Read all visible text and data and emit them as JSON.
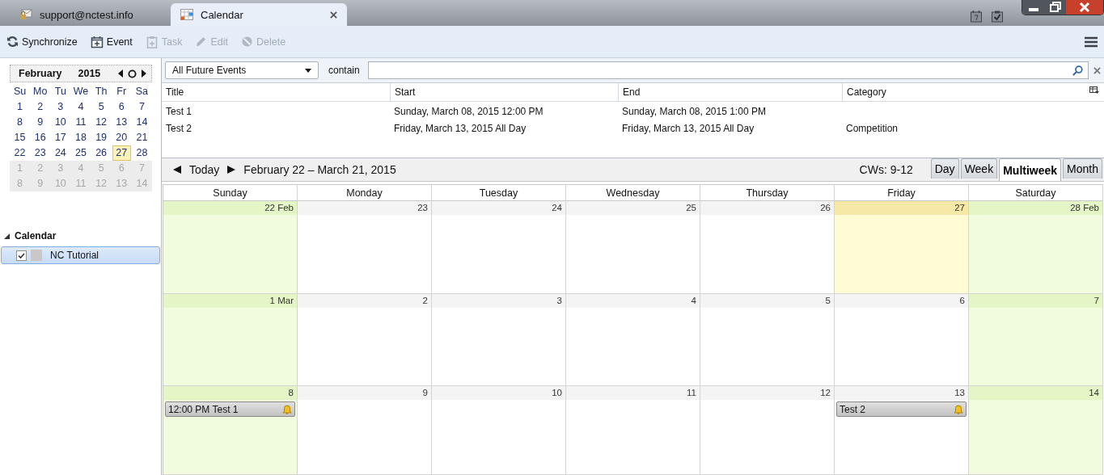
{
  "tabs": [
    {
      "kind": "mail",
      "label": "support@nctest.info",
      "selected": false,
      "closable": false
    },
    {
      "kind": "calendar",
      "label": "Calendar",
      "selected": true,
      "closable": true
    }
  ],
  "toolbar": [
    {
      "kind": "sync",
      "label": "Synchronize",
      "disabled": false
    },
    {
      "kind": "event",
      "label": "Event",
      "disabled": false
    },
    {
      "kind": "task",
      "label": "Task",
      "disabled": true
    },
    {
      "kind": "edit",
      "label": "Edit",
      "disabled": true
    },
    {
      "kind": "delete",
      "label": "Delete",
      "disabled": true
    }
  ],
  "minimonth": {
    "month": "February",
    "year": "2015",
    "weekdays": [
      "Su",
      "Mo",
      "Tu",
      "We",
      "Th",
      "Fr",
      "Sa"
    ],
    "weeks": [
      [
        {
          "day": "1",
          "outside": false,
          "selected": false
        },
        {
          "day": "2",
          "outside": false,
          "selected": false
        },
        {
          "day": "3",
          "outside": false,
          "selected": false
        },
        {
          "day": "4",
          "outside": false,
          "selected": false
        },
        {
          "day": "5",
          "outside": false,
          "selected": false
        },
        {
          "day": "6",
          "outside": false,
          "selected": false
        },
        {
          "day": "7",
          "outside": false,
          "selected": false
        }
      ],
      [
        {
          "day": "8",
          "outside": false,
          "selected": false
        },
        {
          "day": "9",
          "outside": false,
          "selected": false
        },
        {
          "day": "10",
          "outside": false,
          "selected": false
        },
        {
          "day": "11",
          "outside": false,
          "selected": false
        },
        {
          "day": "12",
          "outside": false,
          "selected": false
        },
        {
          "day": "13",
          "outside": false,
          "selected": false
        },
        {
          "day": "14",
          "outside": false,
          "selected": false
        }
      ],
      [
        {
          "day": "15",
          "outside": false,
          "selected": false
        },
        {
          "day": "16",
          "outside": false,
          "selected": false
        },
        {
          "day": "17",
          "outside": false,
          "selected": false
        },
        {
          "day": "18",
          "outside": false,
          "selected": false
        },
        {
          "day": "19",
          "outside": false,
          "selected": false
        },
        {
          "day": "20",
          "outside": false,
          "selected": false
        },
        {
          "day": "21",
          "outside": false,
          "selected": false
        }
      ],
      [
        {
          "day": "22",
          "outside": false,
          "selected": false
        },
        {
          "day": "23",
          "outside": false,
          "selected": false
        },
        {
          "day": "24",
          "outside": false,
          "selected": false
        },
        {
          "day": "25",
          "outside": false,
          "selected": false
        },
        {
          "day": "26",
          "outside": false,
          "selected": false
        },
        {
          "day": "27",
          "outside": false,
          "selected": true
        },
        {
          "day": "28",
          "outside": false,
          "selected": false
        }
      ],
      [
        {
          "day": "1",
          "outside": true,
          "selected": false
        },
        {
          "day": "2",
          "outside": true,
          "selected": false
        },
        {
          "day": "3",
          "outside": true,
          "selected": false
        },
        {
          "day": "4",
          "outside": true,
          "selected": false
        },
        {
          "day": "5",
          "outside": true,
          "selected": false
        },
        {
          "day": "6",
          "outside": true,
          "selected": false
        },
        {
          "day": "7",
          "outside": true,
          "selected": false
        }
      ],
      [
        {
          "day": "8",
          "outside": true,
          "selected": false
        },
        {
          "day": "9",
          "outside": true,
          "selected": false
        },
        {
          "day": "10",
          "outside": true,
          "selected": false
        },
        {
          "day": "11",
          "outside": true,
          "selected": false
        },
        {
          "day": "12",
          "outside": true,
          "selected": false
        },
        {
          "day": "13",
          "outside": true,
          "selected": false
        },
        {
          "day": "14",
          "outside": true,
          "selected": false
        }
      ]
    ]
  },
  "calendars": {
    "heading": "Calendar",
    "expanded": true,
    "items": [
      {
        "name": "NC Tutorial",
        "checked": true,
        "selected": true,
        "color": "#c8c8c8"
      }
    ]
  },
  "filter": {
    "value": "All Future Events",
    "label": "contain"
  },
  "event_list": {
    "columns": [
      "Title",
      "Start",
      "End",
      "Category"
    ],
    "rows": [
      [
        "Test 1",
        "Sunday, March 08, 2015 12:00 PM",
        "Sunday, March 08, 2015 1:00 PM",
        ""
      ],
      [
        "Test 2",
        "Friday, March 13, 2015 All Day",
        "Friday, March 13, 2015 All Day",
        "Competition"
      ]
    ]
  },
  "nav": {
    "today": "Today",
    "range": "February 22 – March 21, 2015",
    "weeks_label": "CWs: 9-12",
    "views": [
      {
        "label": "Day",
        "selected": false
      },
      {
        "label": "Week",
        "selected": false
      },
      {
        "label": "Multiweek",
        "selected": true
      },
      {
        "label": "Month",
        "selected": false
      }
    ]
  },
  "multiweek": {
    "weekdays": [
      "Sunday",
      "Monday",
      "Tuesday",
      "Wednesday",
      "Thursday",
      "Friday",
      "Saturday"
    ],
    "weeks": [
      [
        {
          "label": "22 Feb",
          "weekend": true,
          "today": false
        },
        {
          "label": "23",
          "weekend": false,
          "today": false
        },
        {
          "label": "24",
          "weekend": false,
          "today": false
        },
        {
          "label": "25",
          "weekend": false,
          "today": false
        },
        {
          "label": "26",
          "weekend": false,
          "today": false
        },
        {
          "label": "27",
          "weekend": false,
          "today": true
        },
        {
          "label": "28 Feb",
          "weekend": true,
          "today": false
        }
      ],
      [
        {
          "label": "1 Mar",
          "weekend": true,
          "today": false
        },
        {
          "label": "2",
          "weekend": false,
          "today": false
        },
        {
          "label": "3",
          "weekend": false,
          "today": false
        },
        {
          "label": "4",
          "weekend": false,
          "today": false
        },
        {
          "label": "5",
          "weekend": false,
          "today": false
        },
        {
          "label": "6",
          "weekend": false,
          "today": false
        },
        {
          "label": "7",
          "weekend": true,
          "today": false
        }
      ],
      [
        {
          "label": "8",
          "weekend": true,
          "today": false,
          "events": [
            {
              "text": "12:00 PM Test 1",
              "alarm": true
            }
          ]
        },
        {
          "label": "9",
          "weekend": false,
          "today": false
        },
        {
          "label": "10",
          "weekend": false,
          "today": false
        },
        {
          "label": "11",
          "weekend": false,
          "today": false
        },
        {
          "label": "12",
          "weekend": false,
          "today": false
        },
        {
          "label": "13",
          "weekend": false,
          "today": false,
          "events": [
            {
              "text": "Test 2",
              "alarm": true
            }
          ]
        },
        {
          "label": "14",
          "weekend": true,
          "today": false
        }
      ]
    ]
  }
}
